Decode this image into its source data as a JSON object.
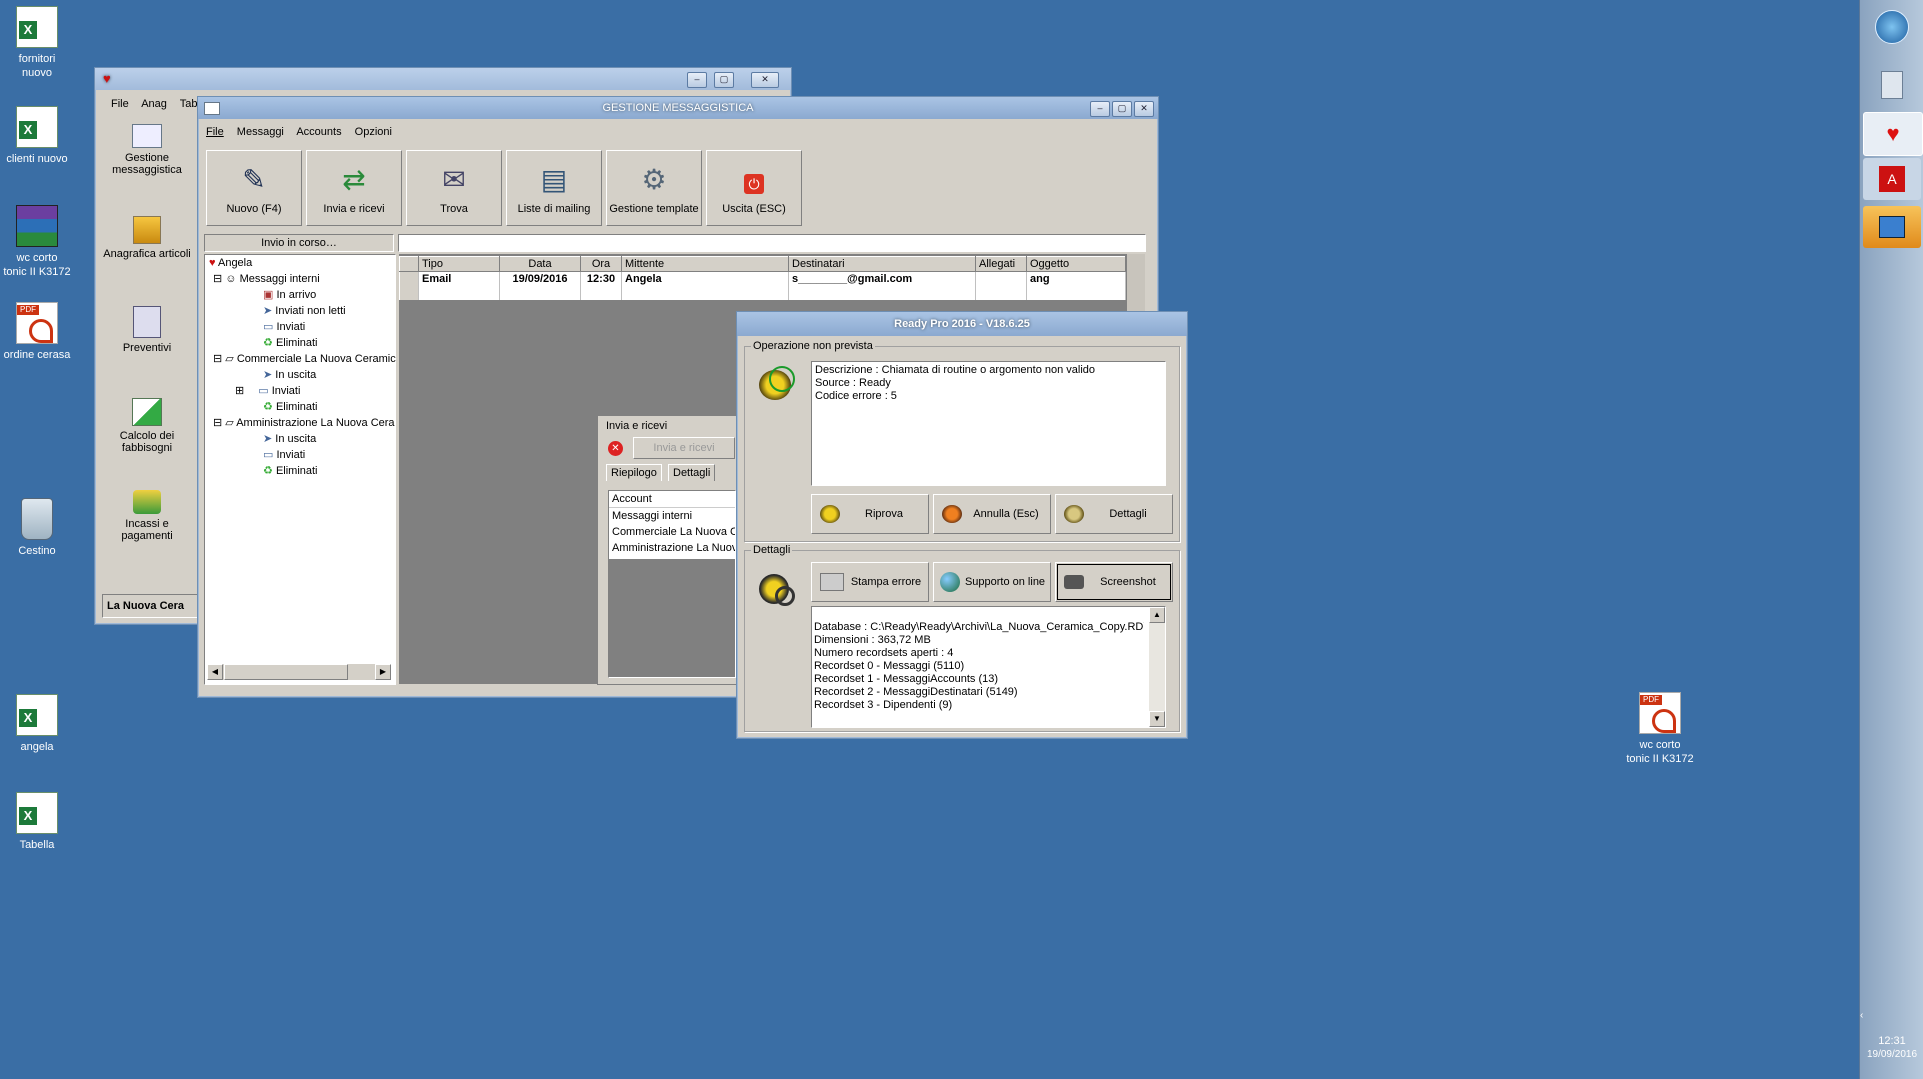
{
  "desktop_icons": [
    {
      "label_line1": "fornitori",
      "label_line2": "nuovo",
      "icon": "excel-file-icon"
    },
    {
      "label_line1": "clienti nuovo",
      "label_line2": "",
      "icon": "excel-file-icon"
    },
    {
      "label_line1": "wc corto",
      "label_line2": "tonic II K3172",
      "icon": "winrar-archive-icon"
    },
    {
      "label_line1": "ordine cerasa",
      "label_line2": "",
      "icon": "pdf-file-icon"
    },
    {
      "label_line1": "Cestino",
      "label_line2": "",
      "icon": "recycle-bin-icon"
    },
    {
      "label_line1": "angela",
      "label_line2": "",
      "icon": "excel-file-icon"
    },
    {
      "label_line1": "Tabella",
      "label_line2": "",
      "icon": "excel-file-icon"
    },
    {
      "label_line1": "wc corto",
      "label_line2": "tonic II K3172",
      "icon": "pdf-document-icon"
    }
  ],
  "taskbar": {
    "time": "12:31",
    "date": "19/09/2016"
  },
  "back_window": {
    "menu": [
      "File",
      "Anag",
      "Tab"
    ],
    "sidebar": [
      {
        "line1": "Gestione",
        "line2": "messaggistica"
      },
      {
        "line1": "Anagrafica articoli",
        "line2": ""
      },
      {
        "line1": "Preventivi",
        "line2": ""
      },
      {
        "line1": "Calcolo dei",
        "line2": "fabbisogni"
      },
      {
        "line1": "Incassi e",
        "line2": "pagamenti"
      }
    ],
    "status": "La Nuova Cera"
  },
  "messaging_window": {
    "title": "GESTIONE MESSAGGISTICA",
    "menu": [
      "File",
      "Messaggi",
      "Accounts",
      "Opzioni"
    ],
    "toolbar": [
      "Nuovo (F4)",
      "Invia e ricevi",
      "Trova",
      "Liste di mailing",
      "Gestione template",
      "Uscita (ESC)"
    ],
    "status_label": "Invio in corso…",
    "tree": {
      "root": "Angela",
      "groups": [
        {
          "name": "Messaggi interni",
          "items": [
            "In arrivo",
            "Inviati non letti",
            "Inviati",
            "Eliminati"
          ]
        },
        {
          "name": "Commerciale La Nuova Ceramic",
          "items": [
            "In uscita",
            "Inviati",
            "Eliminati"
          ]
        },
        {
          "name": "Amministrazione La Nuova Cera",
          "items": [
            "In uscita",
            "Inviati",
            "Eliminati"
          ]
        }
      ]
    },
    "grid": {
      "columns": [
        "Tipo",
        "Data",
        "Ora",
        "Mittente",
        "Destinatari",
        "Allegati",
        "Oggetto"
      ],
      "rows": [
        [
          "Email",
          "19/09/2016",
          "12:30",
          "Angela",
          "s________@gmail.com",
          "",
          "ang"
        ]
      ]
    }
  },
  "send_receive_panel": {
    "title": "Invia e ricevi",
    "button": "Invia e ricevi",
    "tabs": [
      "Riepilogo",
      "Dettagli"
    ],
    "list": [
      "Account",
      "Messaggi interni",
      "Commerciale La Nuova Ce",
      "Amministrazione La Nuova"
    ]
  },
  "error_dialog": {
    "title": "Ready Pro 2016 - V18.6.25",
    "group1": "Operazione non prevista",
    "error_lines": [
      "Descrizione : Chiamata di routine o argomento non valido",
      "Source : Ready",
      "Codice errore : 5"
    ],
    "buttons": [
      "Riprova",
      "Annulla (Esc)",
      "Dettagli"
    ],
    "group2": "Dettagli",
    "buttons2": [
      "Stampa errore",
      "Supporto on line",
      "Screenshot"
    ],
    "details_lines": [
      "Database : C:\\Ready\\Ready\\Archivi\\La_Nuova_Ceramica_Copy.RDY",
      "Dimensioni : 363,72 MB",
      "Numero recordsets aperti : 4",
      "Recordset 0 - Messaggi (5110)",
      "Recordset 1 - MessaggiAccounts (13)",
      "Recordset 2 - MessaggiDestinatari (5149)",
      "Recordset 3 - Dipendenti (9)"
    ]
  }
}
